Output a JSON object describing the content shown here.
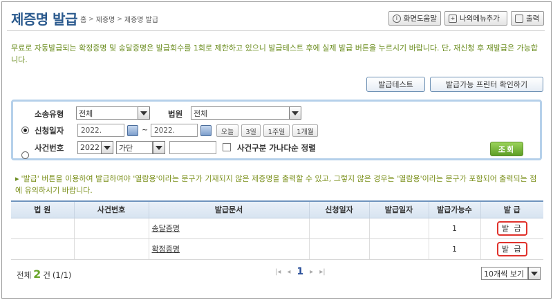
{
  "header": {
    "title": "제증명 발급",
    "breadcrumb": [
      "홈",
      "제증명",
      "제증명 발급"
    ],
    "help_label": "화면도움말",
    "mymenu_label": "나의메뉴추가",
    "print_label": "출력"
  },
  "notice": "무료로 자동발급되는 확정증명 및 송달증명은 발급회수를 1회로 제한하고 있으니 발급테스트 후에 실제 발급 버튼을 누르시기 바랍니다. 단, 재신청 후 재발급은 가능합니다.",
  "actions": {
    "test_label": "발급테스트",
    "printer_label": "발급가능 프린터 확인하기"
  },
  "search": {
    "case_type_label": "소송유형",
    "case_type_value": "전체",
    "court_label": "법원",
    "court_value": "전체",
    "apply_date_label": "신청일자",
    "date_from": "2022.",
    "date_sep": "~",
    "date_to": "2022.",
    "today_label": "오늘",
    "days3_label": "3일",
    "week1_label": "1주일",
    "month1_label": "1개월",
    "case_no_label": "사건번호",
    "year_value": "2022",
    "gubun_value": "가단",
    "case_no_value": "",
    "sort_label": "사건구분 가나다순 정렬",
    "search_label": "조회"
  },
  "warning": "'발급' 버튼을 이용하여 발급하여야 '열람용'이라는 문구가 기재되지 않은 제증명을 출력할 수 있고, 그렇지 않은 경우는 '열람용'이라는 문구가 포함되어 출력되는 점에 유의하시기 바랍니다.",
  "table": {
    "columns": [
      "법 원",
      "사건번호",
      "발급문서",
      "신청일자",
      "발급일자",
      "발급가능수",
      "발 급"
    ],
    "rows": [
      {
        "court": "",
        "case_no": "",
        "doc": "송달증명",
        "apply_date": "",
        "issue_date": "",
        "count": "1",
        "action": "발 급"
      },
      {
        "court": "",
        "case_no": "",
        "doc": "확정증명",
        "apply_date": "",
        "issue_date": "",
        "count": "1",
        "action": "발 급"
      }
    ]
  },
  "footer": {
    "total_prefix": "전체",
    "total_count": "2",
    "total_suffix": "건",
    "page_info": "(1/1)",
    "current_page": "1",
    "page_size": "10개씩 보기"
  },
  "colors": {
    "accent": "#2b5a8e",
    "notice": "#6a8c1e",
    "issue_border": "#e0312b",
    "search_btn": "#6aa52a"
  }
}
